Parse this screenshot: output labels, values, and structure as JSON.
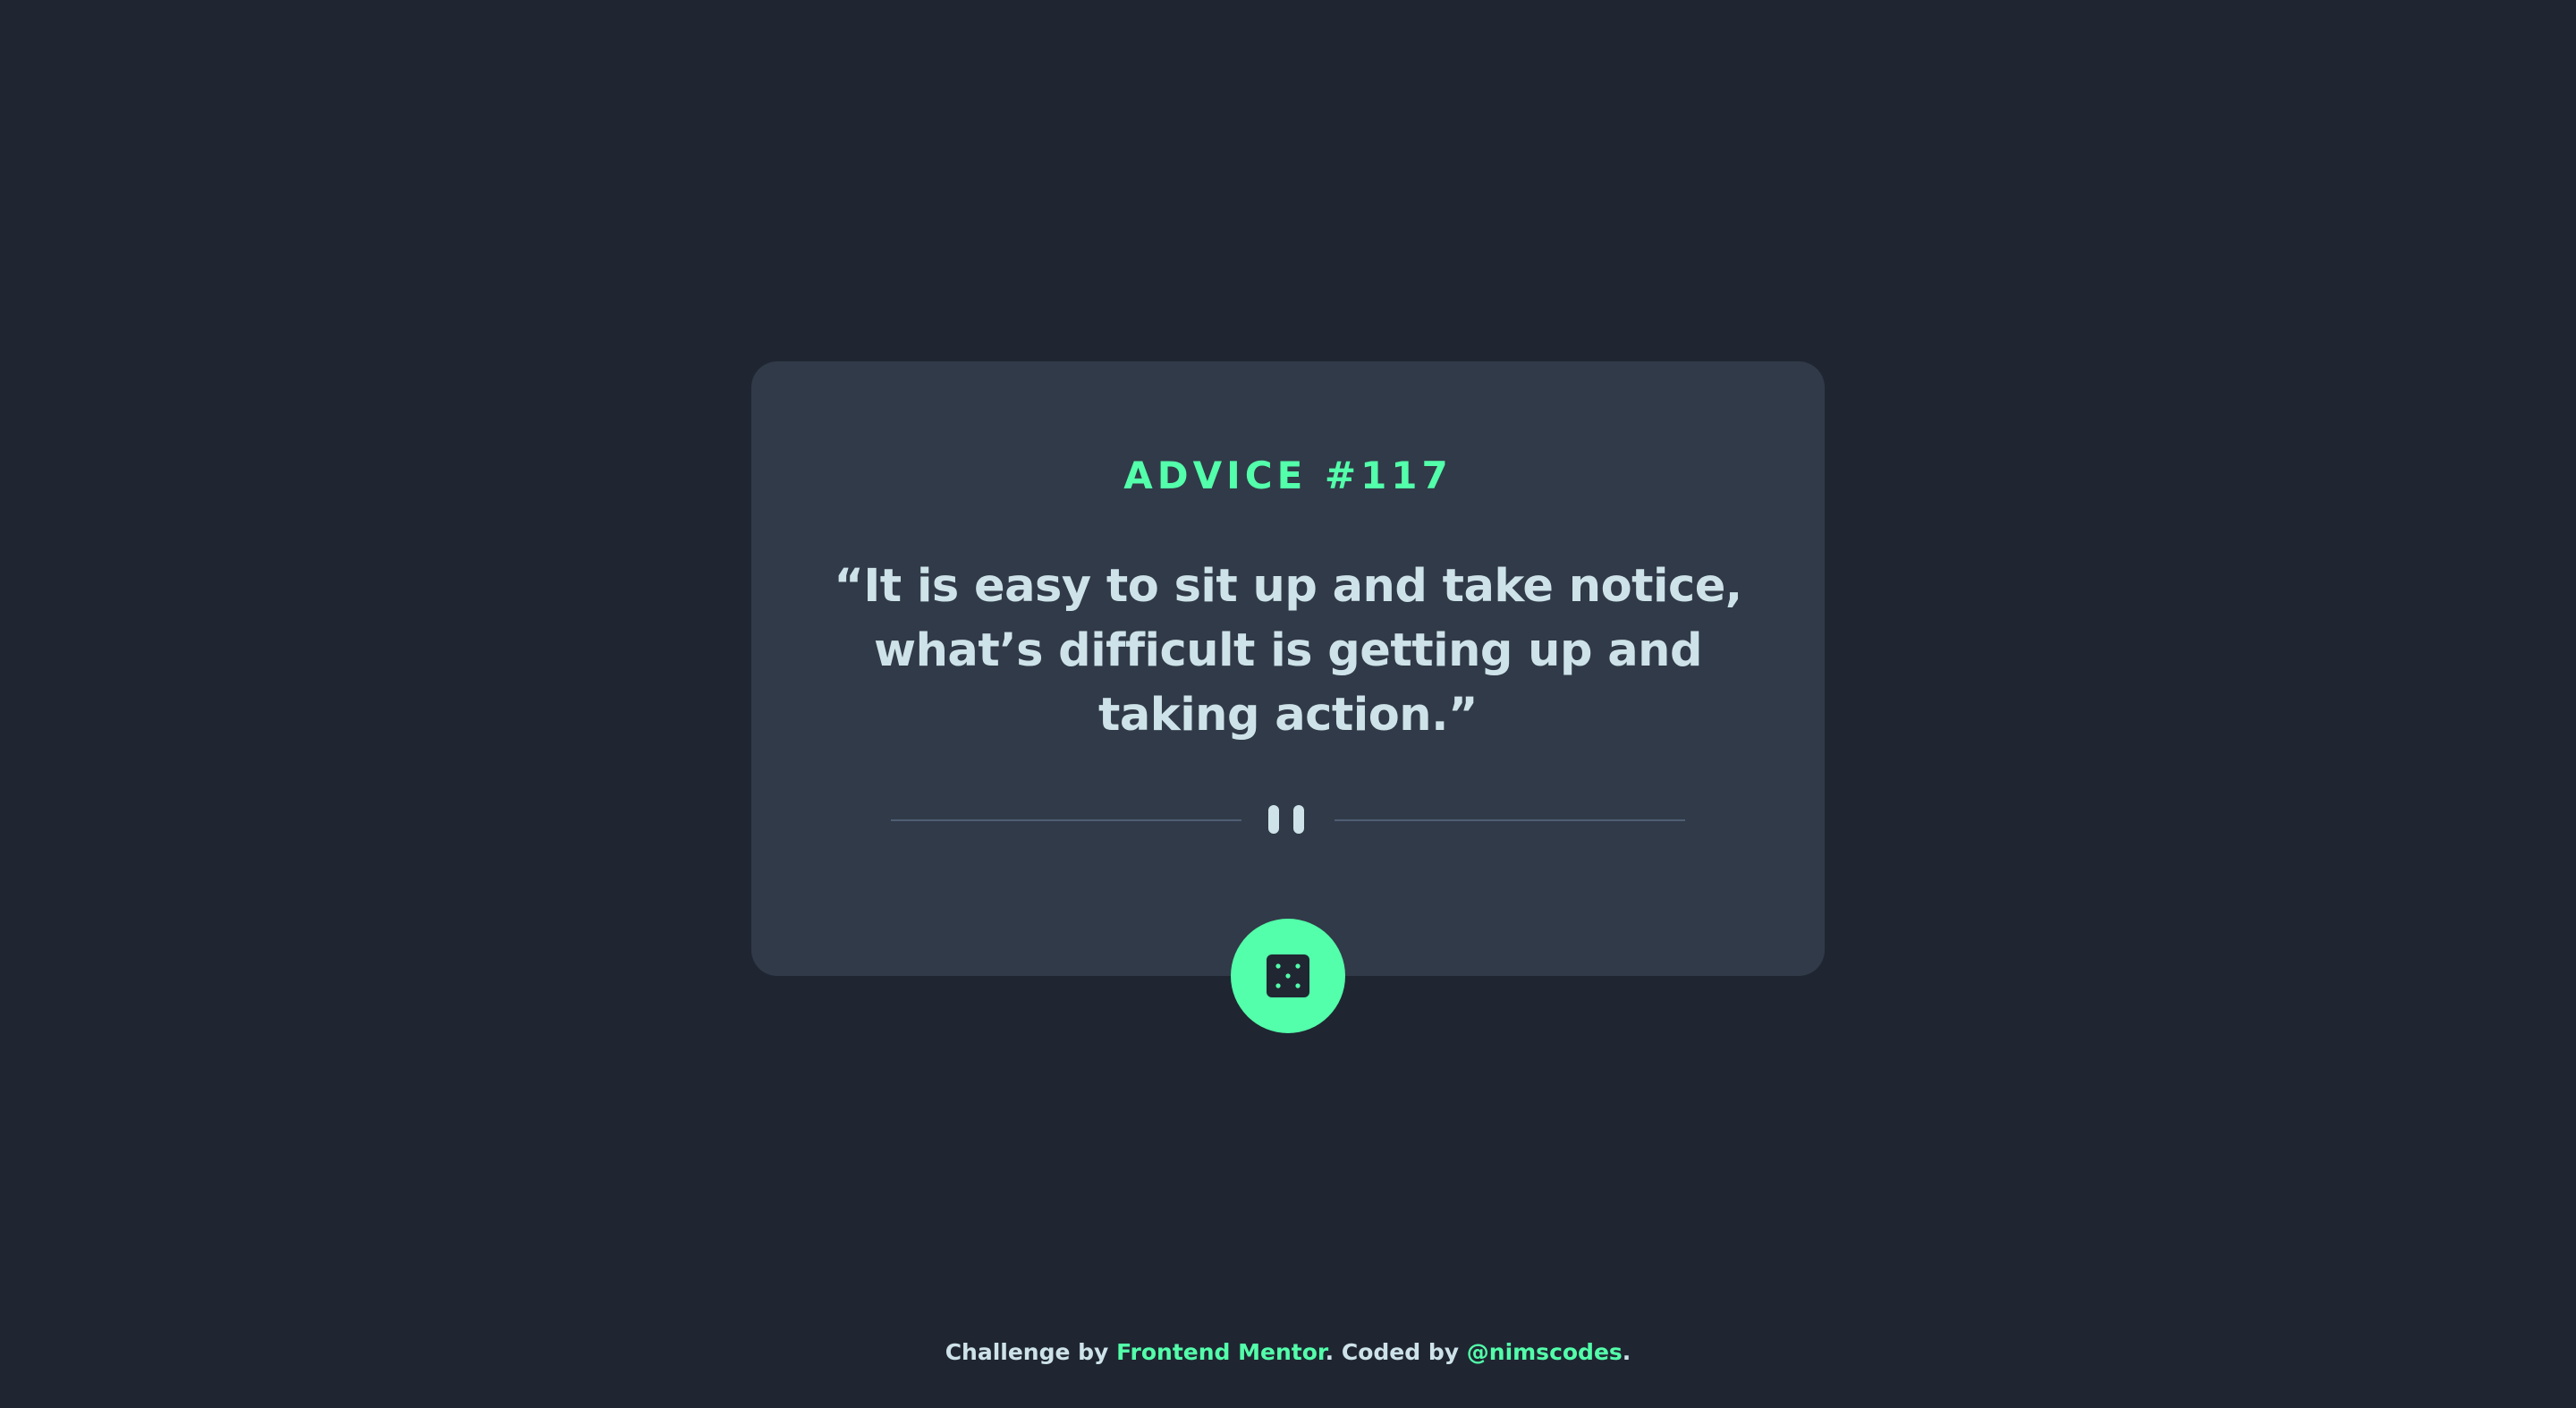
{
  "card": {
    "advice_label": "ADVICE #117",
    "quote": "“It is easy to sit up and take notice, what’s difficult is getting up and taking action.”"
  },
  "dice_button": {
    "icon": "dice-icon",
    "accent": "#53ffaa"
  },
  "footer": {
    "prefix": "Challenge by",
    "link1": "Frontend Mentor",
    "middle": ". Coded by",
    "link2": "@nimscodes",
    "suffix": "."
  },
  "colors": {
    "background": "#1f2632",
    "card": "#313a48",
    "accent": "#53ffaa",
    "text": "#cee3e9",
    "divider": "#4f5d74"
  }
}
